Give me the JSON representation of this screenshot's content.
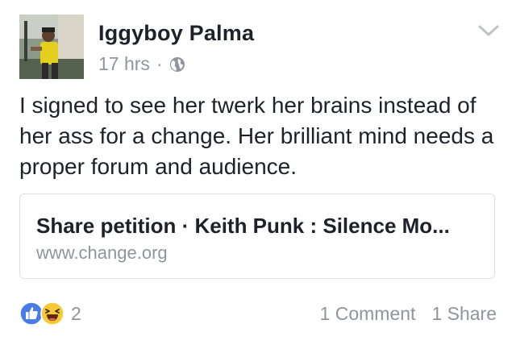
{
  "post": {
    "author": "Iggyboy Palma",
    "timestamp": "17 hrs",
    "separator": "·",
    "privacy_icon": "globe-icon",
    "menu_icon": "chevron-down-icon",
    "text": "I signed to see her twerk her brains instead of her ass for a change. Her brilliant mind needs a proper forum and audience.",
    "link": {
      "title": "Share petition · Keith Punk : Silence Mo...",
      "domain": "www.change.org"
    },
    "reactions": {
      "icons": [
        "like-icon",
        "haha-icon"
      ],
      "count": "2"
    },
    "comments": "1 Comment",
    "shares": "1 Share"
  },
  "colors": {
    "text": "#1d2129",
    "secondary": "#90949c",
    "like_blue": "#4a7ce8",
    "haha_yellow": "#f7c835",
    "card_border": "#dddfe2"
  }
}
